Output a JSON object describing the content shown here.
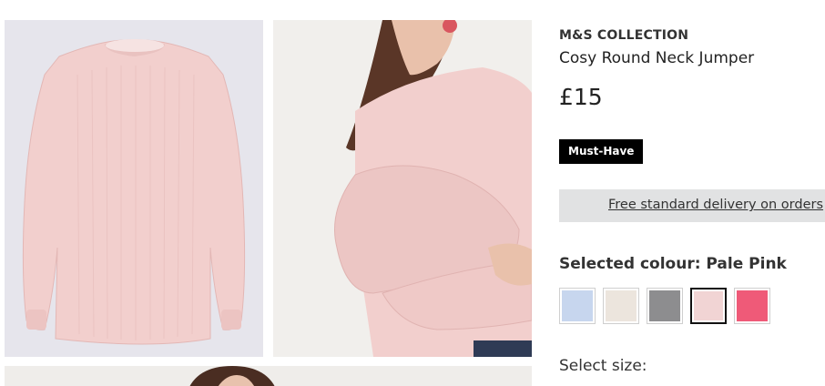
{
  "product": {
    "brand": "M&S COLLECTION",
    "title": "Cosy Round Neck Jumper",
    "price": "£15",
    "badge": "Must-Have"
  },
  "delivery": {
    "text": "Free standard delivery on orders"
  },
  "colour": {
    "label": "Selected colour:",
    "selected": "Pale Pink",
    "swatches": [
      {
        "name": "light-blue",
        "color": "#c7d6ee"
      },
      {
        "name": "cream",
        "color": "#ece5dd"
      },
      {
        "name": "grey",
        "color": "#8d8d8f"
      },
      {
        "name": "pale-pink",
        "color": "#f1d4d4",
        "selected": true
      },
      {
        "name": "bright-pink",
        "color": "#ef5a78"
      }
    ]
  },
  "size": {
    "label": "Select size:"
  },
  "colors": {
    "jumper_pink": "#f2cfcd",
    "jumper_shadow": "#e3b7b5",
    "hair": "#5a3627",
    "skin": "#e9c1ab",
    "badge_bg": "#000000",
    "delivery_bg": "#e1e2e3"
  }
}
